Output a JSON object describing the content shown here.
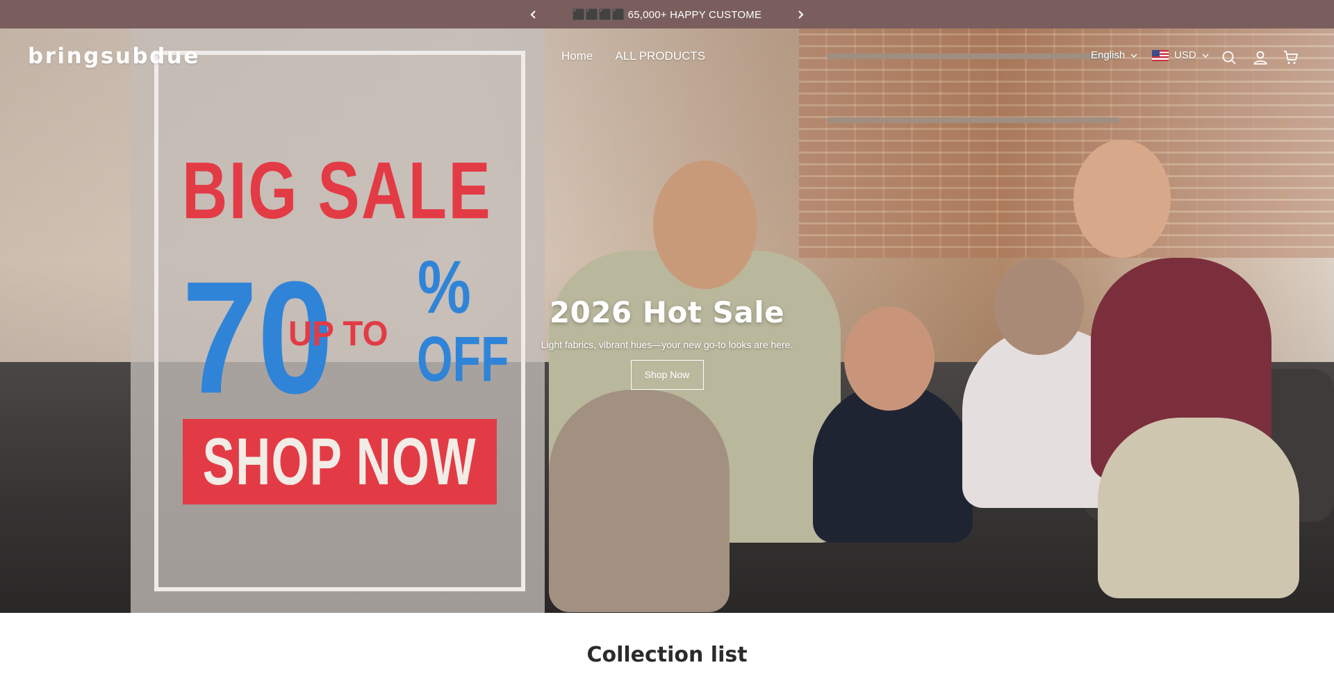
{
  "announcement": {
    "text": "⬛⬛⬛⬛ 65,000+ HAPPY CUSTOME",
    "prev_icon": "chevron-left-icon",
    "next_icon": "chevron-right-icon",
    "background": "#7a5e5e"
  },
  "header": {
    "logo": "bringsubdue",
    "nav": [
      {
        "label": "Home"
      },
      {
        "label": "ALL PRODUCTS"
      }
    ],
    "language": "English",
    "currency": "USD",
    "icons": [
      "search-icon",
      "account-icon",
      "cart-icon"
    ]
  },
  "hero": {
    "banner": {
      "line1": "BIG SALE",
      "percent": "70",
      "upto": "UP TO",
      "percent_sign": "%",
      "off": "OFF",
      "cta": "SHOP NOW",
      "red": "#e33b45",
      "blue": "#2f84d8"
    },
    "title": "2026 Hot Sale",
    "subtitle": "Light fabrics, vibrant hues—your new go-to looks are here.",
    "button": "Shop Now"
  },
  "collection": {
    "title": "Collection list"
  }
}
